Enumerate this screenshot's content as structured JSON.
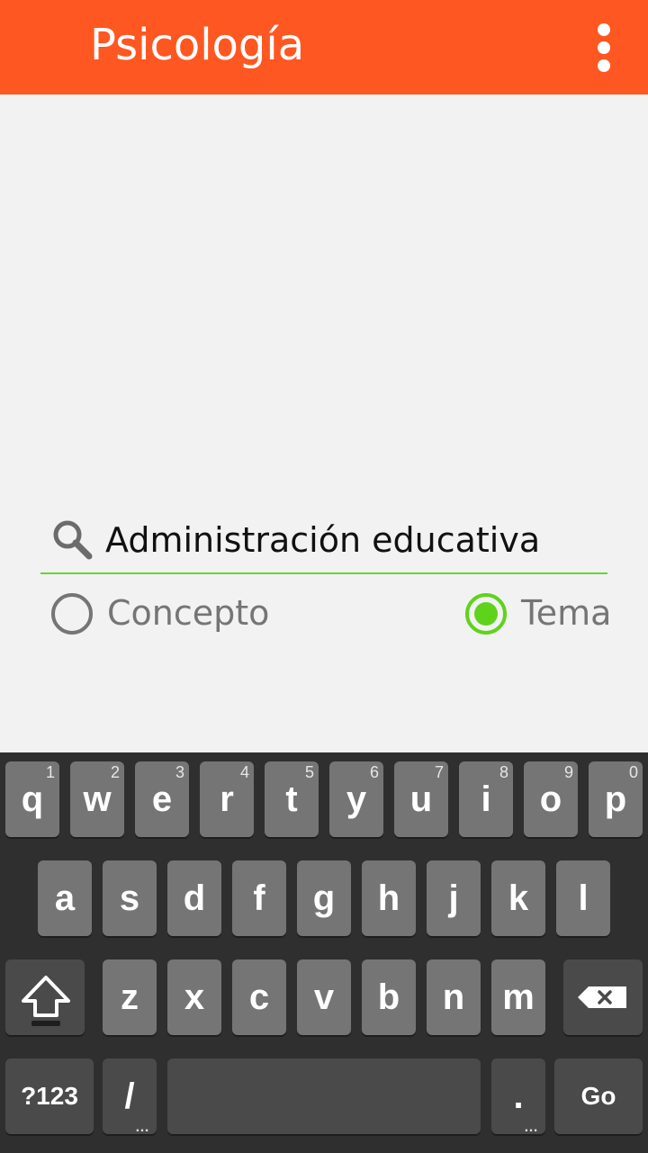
{
  "app": {
    "title": "Psicología",
    "menu_icon": "more-vert-icon"
  },
  "search": {
    "icon": "search-icon",
    "value": "Administración educativa",
    "accent_color": "#66d630"
  },
  "filters": {
    "options": [
      {
        "label": "Concepto",
        "checked": false
      },
      {
        "label": "Tema",
        "checked": true
      }
    ],
    "checked_color": "#5fd31c"
  },
  "theme": {
    "primary": "#ff5722",
    "background": "#f2f2f2"
  },
  "keyboard": {
    "row1": [
      {
        "key": "q",
        "hint": "1"
      },
      {
        "key": "w",
        "hint": "2"
      },
      {
        "key": "e",
        "hint": "3"
      },
      {
        "key": "r",
        "hint": "4"
      },
      {
        "key": "t",
        "hint": "5"
      },
      {
        "key": "y",
        "hint": "6"
      },
      {
        "key": "u",
        "hint": "7"
      },
      {
        "key": "i",
        "hint": "8"
      },
      {
        "key": "o",
        "hint": "9"
      },
      {
        "key": "p",
        "hint": "0"
      }
    ],
    "row2": [
      "a",
      "s",
      "d",
      "f",
      "g",
      "h",
      "j",
      "k",
      "l"
    ],
    "row3": [
      "z",
      "x",
      "c",
      "v",
      "b",
      "n",
      "m"
    ],
    "shift_icon": "shift-icon",
    "backspace_icon": "backspace-icon",
    "symbols_label": "?123",
    "slash_label": "/",
    "slash_sub": "…",
    "period_label": ".",
    "period_sub": "…",
    "go_label": "Go"
  }
}
